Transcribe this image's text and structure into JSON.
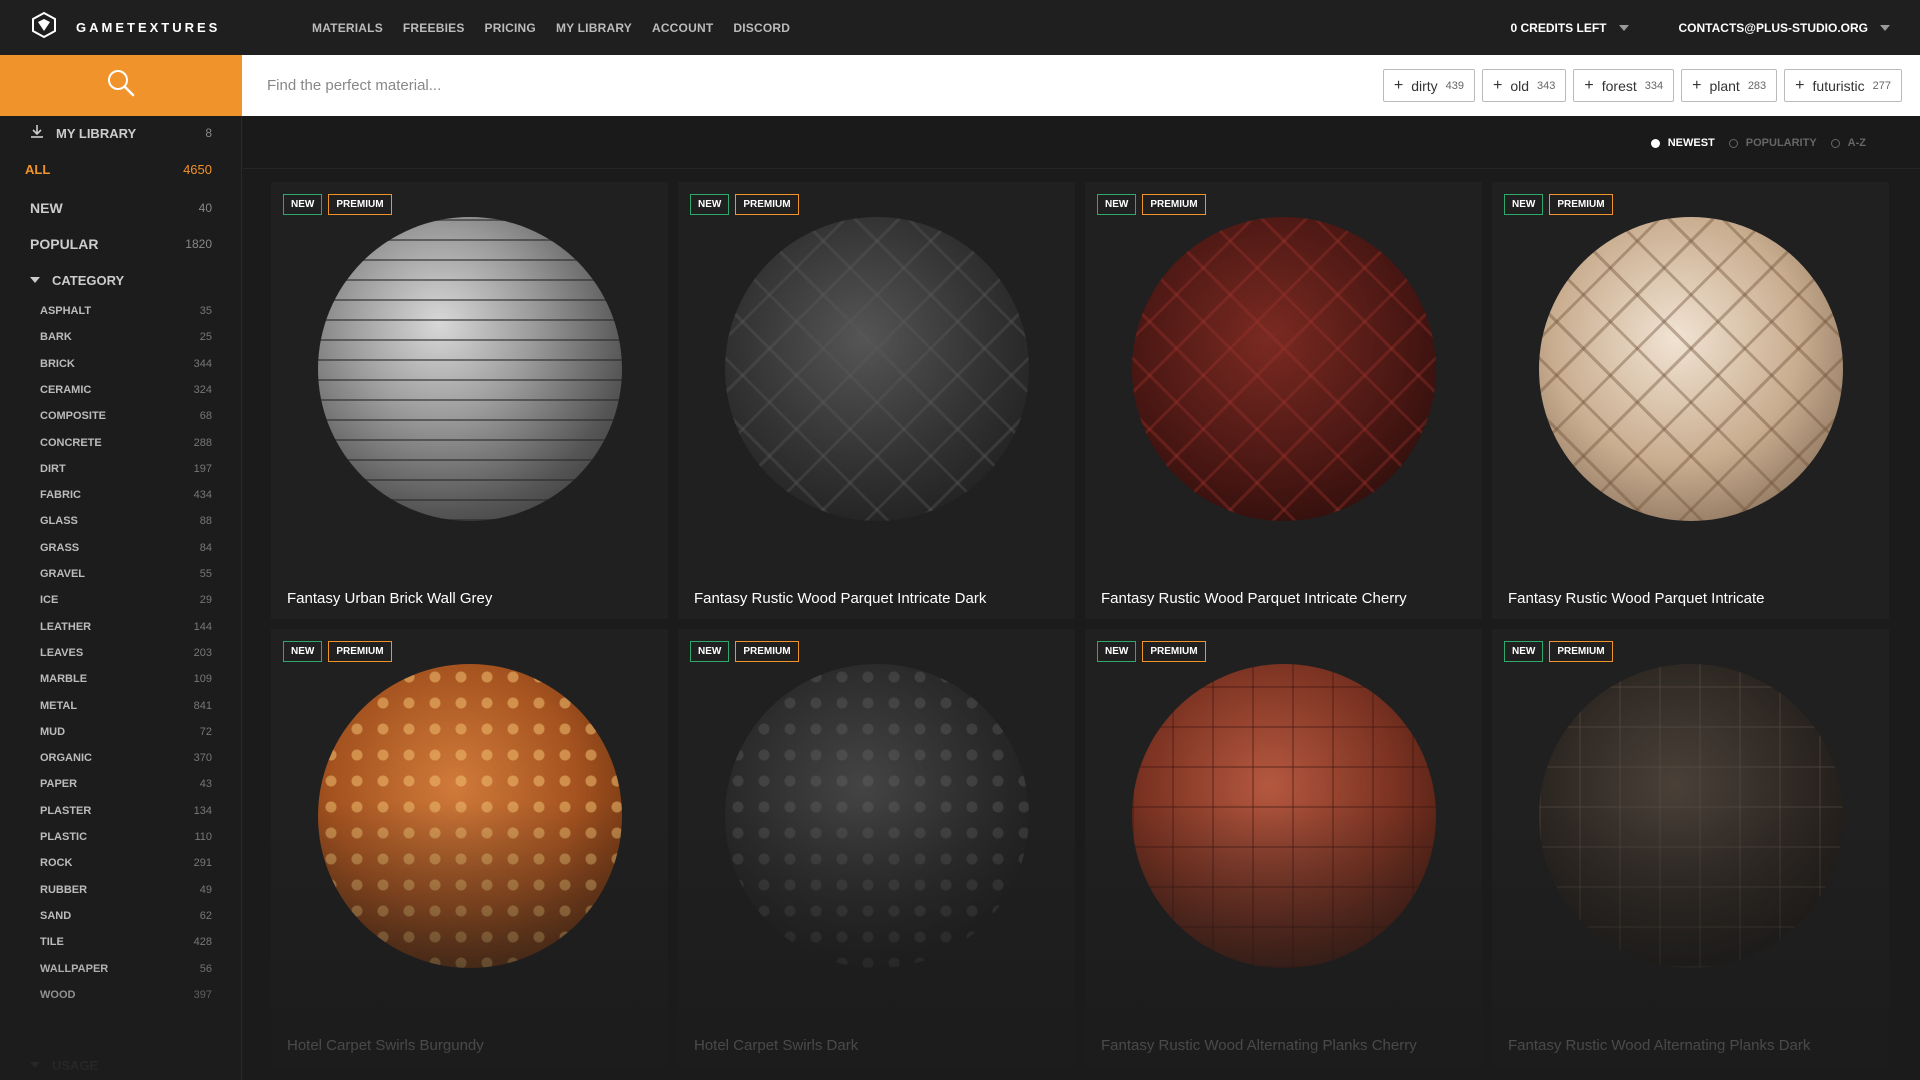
{
  "brand": {
    "name": "GAMETEXTURES",
    "logo_icon": "gametextures-logo-icon"
  },
  "nav": [
    "MATERIALS",
    "FREEBIES",
    "PRICING",
    "MY LIBRARY",
    "ACCOUNT",
    "DISCORD"
  ],
  "account": {
    "credits": "0 CREDITS LEFT",
    "email": "CONTACTS@PLUS-STUDIO.ORG"
  },
  "search": {
    "placeholder": "Find the perfect material...",
    "icon": "search-icon"
  },
  "tags": [
    {
      "label": "dirty",
      "count": "439"
    },
    {
      "label": "old",
      "count": "343"
    },
    {
      "label": "forest",
      "count": "334"
    },
    {
      "label": "plant",
      "count": "283"
    },
    {
      "label": "futuristic",
      "count": "277"
    }
  ],
  "sidebar": {
    "my_library": {
      "label": "MY LIBRARY",
      "count": "8"
    },
    "all": {
      "label": "ALL",
      "count": "4650"
    },
    "new": {
      "label": "NEW",
      "count": "40"
    },
    "popular": {
      "label": "POPULAR",
      "count": "1820"
    },
    "category_label": "CATEGORY",
    "categories": [
      {
        "label": "ASPHALT",
        "count": "35"
      },
      {
        "label": "BARK",
        "count": "25"
      },
      {
        "label": "BRICK",
        "count": "344"
      },
      {
        "label": "CERAMIC",
        "count": "324"
      },
      {
        "label": "COMPOSITE",
        "count": "68"
      },
      {
        "label": "CONCRETE",
        "count": "288"
      },
      {
        "label": "DIRT",
        "count": "197"
      },
      {
        "label": "FABRIC",
        "count": "434"
      },
      {
        "label": "GLASS",
        "count": "88"
      },
      {
        "label": "GRASS",
        "count": "84"
      },
      {
        "label": "GRAVEL",
        "count": "55"
      },
      {
        "label": "ICE",
        "count": "29"
      },
      {
        "label": "LEATHER",
        "count": "144"
      },
      {
        "label": "LEAVES",
        "count": "203"
      },
      {
        "label": "MARBLE",
        "count": "109"
      },
      {
        "label": "METAL",
        "count": "841"
      },
      {
        "label": "MUD",
        "count": "72"
      },
      {
        "label": "ORGANIC",
        "count": "370"
      },
      {
        "label": "PAPER",
        "count": "43"
      },
      {
        "label": "PLASTER",
        "count": "134"
      },
      {
        "label": "PLASTIC",
        "count": "110"
      },
      {
        "label": "ROCK",
        "count": "291"
      },
      {
        "label": "RUBBER",
        "count": "49"
      },
      {
        "label": "SAND",
        "count": "62"
      },
      {
        "label": "TILE",
        "count": "428"
      },
      {
        "label": "WALLPAPER",
        "count": "56"
      },
      {
        "label": "WOOD",
        "count": "397"
      }
    ],
    "usage_label": "USAGE"
  },
  "sort": {
    "options": [
      "NEWEST",
      "POPULARITY",
      "A-Z"
    ],
    "selected": "NEWEST"
  },
  "badges": {
    "new": "NEW",
    "premium": "PREMIUM"
  },
  "materials": [
    {
      "title": "Fantasy Urban Brick Wall Grey",
      "swatch": "s1"
    },
    {
      "title": "Fantasy Rustic Wood Parquet Intricate Dark",
      "swatch": "s2"
    },
    {
      "title": "Fantasy Rustic Wood Parquet Intricate Cherry",
      "swatch": "s3"
    },
    {
      "title": "Fantasy Rustic Wood Parquet Intricate",
      "swatch": "s4"
    },
    {
      "title": "Hotel Carpet Swirls Burgundy",
      "swatch": "s5"
    },
    {
      "title": "Hotel Carpet Swirls Dark",
      "swatch": "s6"
    },
    {
      "title": "Fantasy Rustic Wood Alternating Planks Cherry",
      "swatch": "s7"
    },
    {
      "title": "Fantasy Rustic Wood Alternating Planks Dark",
      "swatch": "s8"
    }
  ],
  "colors": {
    "accent": "#f0932a",
    "new_badge": "#2fa86b",
    "premium_badge": "#f0932a"
  }
}
